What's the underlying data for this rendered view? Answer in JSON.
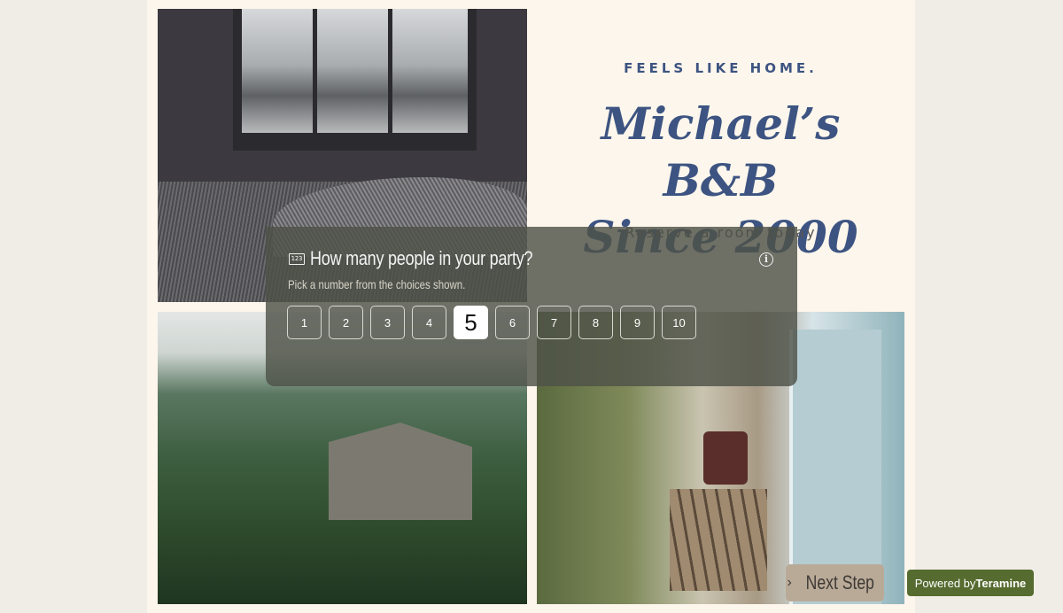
{
  "hero": {
    "tagline": "FEELS LIKE HOME.",
    "title_line1": "Michael’s B&B",
    "title_line2": "Since 2000",
    "subtitle": "Reserve a room today"
  },
  "photos": [
    {
      "id": "bedroom",
      "alt": "Bedroom window with misty view"
    },
    {
      "id": "jungle",
      "alt": "Wooden house in jungle"
    },
    {
      "id": "porch",
      "alt": "Sunroom porch with open door"
    }
  ],
  "question": {
    "icon": "number-input-icon",
    "icon_text": "123",
    "title": "How many people in your party?",
    "subtitle": "Pick a number from the choices shown.",
    "info_icon": "info-icon",
    "choices": [
      "1",
      "2",
      "3",
      "4",
      "5",
      "6",
      "7",
      "8",
      "9",
      "10"
    ],
    "selected": "5"
  },
  "next_button": {
    "chevron": "›",
    "label": "Next Step"
  },
  "powered_by": {
    "prefix": "Powered by",
    "brand": "Teramine"
  },
  "colors": {
    "page_bg": "#f0ede6",
    "panel_bg": "#fdf6ec",
    "heading": "#3d5482",
    "overlay": "#4e5248",
    "next_button": "#b9aa98",
    "powered_bg": "#556b2f"
  }
}
